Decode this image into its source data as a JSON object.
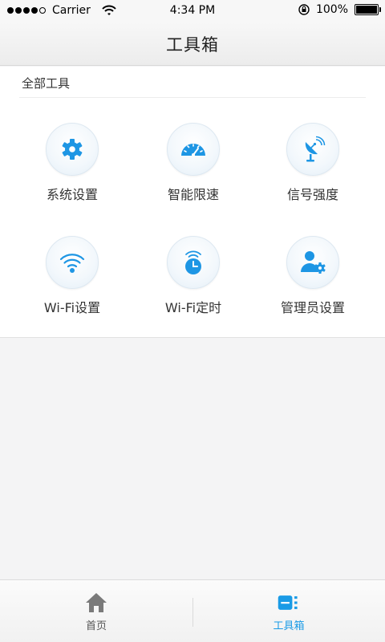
{
  "status_bar": {
    "carrier": "Carrier",
    "time": "4:34 PM",
    "battery": "100%",
    "icons": [
      "signal-dots-icon",
      "wifi-icon",
      "rotation-lock-icon",
      "battery-icon"
    ]
  },
  "nav": {
    "title": "工具箱"
  },
  "section": {
    "title": "全部工具"
  },
  "tools": [
    {
      "label": "系统设置",
      "icon": "gear-icon"
    },
    {
      "label": "智能限速",
      "icon": "speedometer-icon"
    },
    {
      "label": "信号强度",
      "icon": "satellite-dish-icon"
    },
    {
      "label": "Wi-Fi设置",
      "icon": "wifi-icon"
    },
    {
      "label": "Wi-Fi定时",
      "icon": "wifi-clock-icon"
    },
    {
      "label": "管理员设置",
      "icon": "admin-user-gear-icon"
    }
  ],
  "tabbar": {
    "tabs": [
      {
        "label": "首页",
        "icon": "home-icon",
        "active": false
      },
      {
        "label": "工具箱",
        "icon": "toolbox-icon",
        "active": true
      }
    ]
  },
  "colors": {
    "accent": "#1a9be6",
    "icon_blue": "#1e96e4",
    "inactive_tab": "#7a7a7a",
    "background": "#f4f4f5",
    "panel": "#ffffff"
  }
}
